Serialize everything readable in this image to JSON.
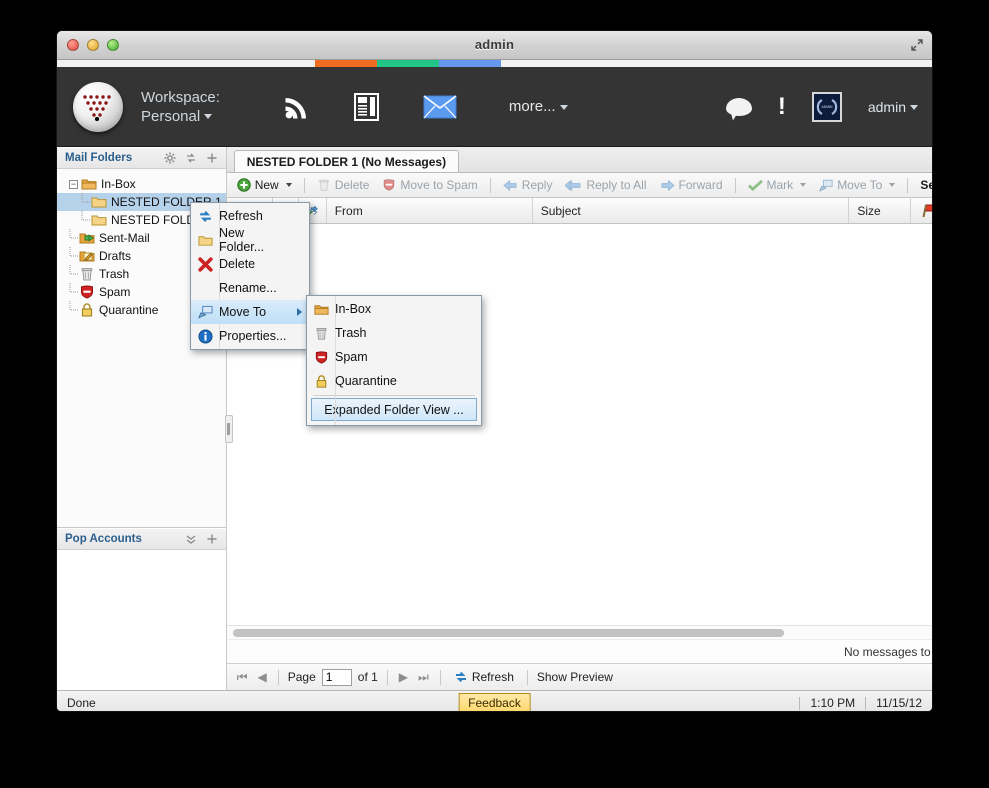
{
  "window": {
    "title": "admin"
  },
  "header": {
    "workspace_label": "Workspace:",
    "workspace_value": "Personal",
    "more_label": "more...",
    "username": "admin",
    "avatar_text": "ADMIN",
    "icons": [
      "rss-icon",
      "news-icon",
      "mail-icon",
      "chat-icon",
      "alert-icon"
    ]
  },
  "sidebar": {
    "mail_folders": {
      "title": "Mail Folders",
      "icons": [
        "gear-icon",
        "refresh-icon",
        "plus-icon"
      ],
      "items": [
        {
          "label": "In-Box",
          "icon": "inbox-folder-icon",
          "level": 0,
          "expander": "-",
          "selected": false
        },
        {
          "label": "NESTED FOLDER 1",
          "icon": "folder-icon",
          "level": 1,
          "selected": true
        },
        {
          "label": "NESTED FOLDER 2",
          "icon": "folder-icon",
          "level": 1,
          "selected": false
        },
        {
          "label": "Sent-Mail",
          "icon": "sent-mail-icon",
          "level": 0,
          "selected": false
        },
        {
          "label": "Drafts",
          "icon": "drafts-icon",
          "level": 0,
          "selected": false
        },
        {
          "label": "Trash",
          "icon": "trash-icon",
          "level": 0,
          "selected": false
        },
        {
          "label": "Spam",
          "icon": "spam-icon",
          "level": 0,
          "selected": false
        },
        {
          "label": "Quarantine",
          "icon": "quarantine-lock-icon",
          "level": 0,
          "selected": false
        }
      ]
    },
    "pop_accounts": {
      "title": "Pop Accounts",
      "icons": [
        "chevrons-down-icon",
        "plus-icon"
      ]
    }
  },
  "main": {
    "tab_label": "NESTED FOLDER 1 (No Messages)",
    "toolbar": {
      "new_label": "New",
      "delete_label": "Delete",
      "move_to_spam_label": "Move to Spam",
      "reply_label": "Reply",
      "reply_all_label": "Reply to All",
      "forward_label": "Forward",
      "mark_label": "Mark",
      "move_to_label": "Move To",
      "search_label": "Search"
    },
    "columns": [
      "From",
      "Subject",
      "Size"
    ],
    "column_icons": [
      "attachment-col-icon",
      "status-col-icon",
      "flag-col-icon",
      "paperclip-col-icon"
    ],
    "empty_message": "No messages to display",
    "pager": {
      "page_label": "Page",
      "page_value": "1",
      "of_label": "of 1",
      "refresh_label": "Refresh",
      "show_preview_label": "Show Preview"
    }
  },
  "context_menu": {
    "items": [
      {
        "label": "Refresh",
        "icon": "refresh-icon",
        "highlighted": false,
        "submenu": false
      },
      {
        "label": "New Folder...",
        "icon": "new-folder-icon",
        "highlighted": false,
        "submenu": false
      },
      {
        "label": "Delete",
        "icon": "delete-x-icon",
        "highlighted": false,
        "submenu": false
      },
      {
        "label": "Rename...",
        "icon": "",
        "highlighted": false,
        "submenu": false
      },
      {
        "label": "Move To",
        "icon": "move-to-icon",
        "highlighted": true,
        "submenu": true
      },
      {
        "label": "Properties...",
        "icon": "info-icon",
        "highlighted": false,
        "submenu": false
      }
    ]
  },
  "submenu": {
    "items": [
      {
        "label": "In-Box",
        "icon": "inbox-folder-icon"
      },
      {
        "label": "Trash",
        "icon": "trash-icon"
      },
      {
        "label": "Spam",
        "icon": "spam-icon"
      },
      {
        "label": "Quarantine",
        "icon": "quarantine-lock-icon"
      }
    ],
    "expanded_label": "Expanded Folder View ..."
  },
  "statusbar": {
    "status": "Done",
    "feedback_label": "Feedback",
    "time": "1:10 PM",
    "date": "11/15/12"
  },
  "colors": {
    "accent_blue": "#6699ee",
    "accent_orange": "#ef6c20",
    "accent_green": "#22c487",
    "header_bg": "#343434",
    "selection": "#b5d2ea",
    "link_blue": "#2b5f8e"
  }
}
